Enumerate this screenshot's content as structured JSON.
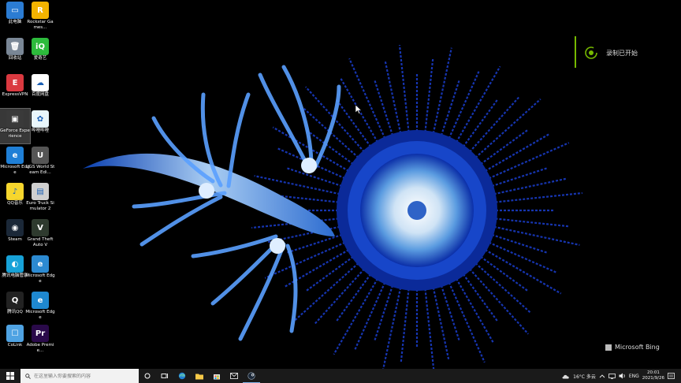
{
  "desktop": {
    "icons": [
      {
        "label": "此电脑",
        "color": "#2b7cd3",
        "glyph": "▭"
      },
      {
        "label": "Rockstar Games...",
        "color": "#f4b400",
        "glyph": "R"
      },
      {
        "label": "回收站",
        "color": "#7a8796",
        "glyph": "🗑"
      },
      {
        "label": "爱奇艺",
        "color": "#2dbb3c",
        "glyph": "iQ"
      },
      {
        "label": "ExpressVPN",
        "color": "#da3940",
        "glyph": "E"
      },
      {
        "label": "百度网盘",
        "color": "#ffffff",
        "glyph": "☁"
      },
      {
        "label": "GeForce Experience",
        "color": "#3a3a3a",
        "glyph": "▣"
      },
      {
        "label": "哔哩哔哩",
        "color": "#e9f6fb",
        "glyph": "✿"
      },
      {
        "label": "Microsoft Edge",
        "color": "#1f7fd6",
        "glyph": "e"
      },
      {
        "label": "UGS World Steam Edi...",
        "color": "#555555",
        "glyph": "U"
      },
      {
        "label": "QQ音乐",
        "color": "#f6d62d",
        "glyph": "♪"
      },
      {
        "label": "Euro Truck Simulator 2",
        "color": "#cfcfcf",
        "glyph": "▤"
      },
      {
        "label": "Steam",
        "color": "#1b2838",
        "glyph": "◉"
      },
      {
        "label": "Grand Theft Auto V",
        "color": "#2e3a2e",
        "glyph": "V"
      },
      {
        "label": "腾讯电脑管家",
        "color": "#17a2d8",
        "glyph": "◐"
      },
      {
        "label": "Microsoft Edge",
        "color": "#2c8ad1",
        "glyph": "e"
      },
      {
        "label": "腾讯QQ",
        "color": "#222222",
        "glyph": "Q"
      },
      {
        "label": "Microsoft Edge",
        "color": "#1e88d0",
        "glyph": "e"
      },
      {
        "label": "CoLink",
        "color": "#4fa3e3",
        "glyph": "☐"
      },
      {
        "label": "Adobe Premie...",
        "color": "#2a0a4a",
        "glyph": "Pr"
      }
    ]
  },
  "toast": {
    "text": "录制已开始"
  },
  "bing": {
    "text": "Microsoft Bing"
  },
  "taskbar": {
    "search_placeholder": "在这里输入你要搜索的内容",
    "tray": {
      "weather": "16°C 多云",
      "lang": "ENG",
      "time": "20:01",
      "date": "2021/9/26"
    }
  },
  "colors": {
    "accent": "#76b900",
    "taskbar": "#1a1a1a",
    "active_underline": "#7fb2e8"
  }
}
